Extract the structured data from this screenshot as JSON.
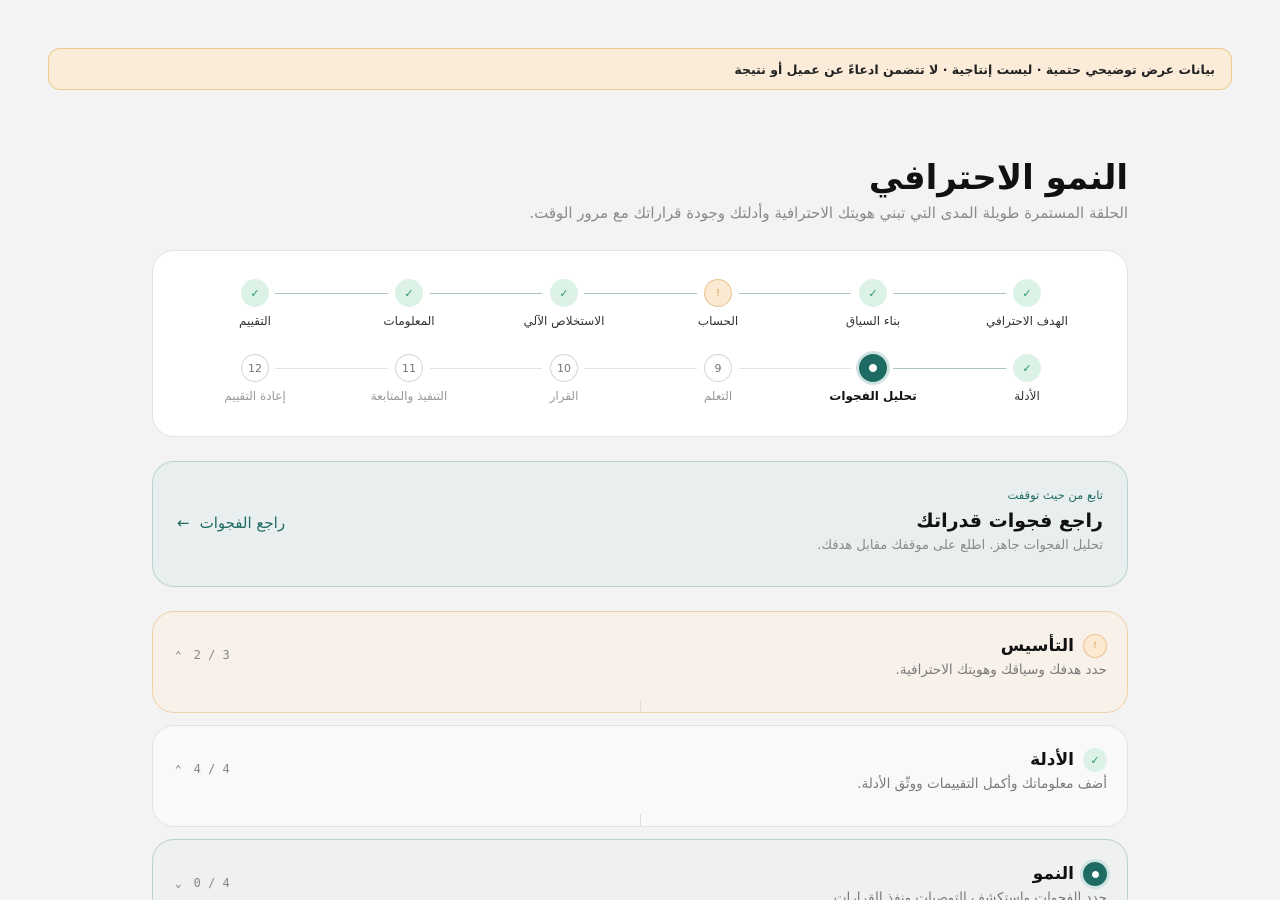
{
  "banner": {
    "text": "بيانات عرض توضيحي حتمية · ليست إنتاجية · لا تتضمن ادعاءً عن عميل أو نتيجة"
  },
  "header": {
    "title": "النمو الاحترافي",
    "subtitle": "الحلقة المستمرة طويلة المدى التي تبني هويتك الاحترافية وأدلتك وجودة قراراتك مع مرور الوقت."
  },
  "stepper": {
    "row1": [
      {
        "label": "الهدف الاحترافي",
        "status": "done",
        "marker": "✓"
      },
      {
        "label": "بناء السياق",
        "status": "done",
        "marker": "✓"
      },
      {
        "label": "الحساب",
        "status": "warn",
        "marker": "!"
      },
      {
        "label": "الاستخلاص الآلي",
        "status": "done",
        "marker": "✓"
      },
      {
        "label": "المعلومات",
        "status": "done",
        "marker": "✓"
      },
      {
        "label": "التقييم",
        "status": "done",
        "marker": "✓"
      }
    ],
    "row2": [
      {
        "label": "الأدلة",
        "status": "done",
        "marker": "✓"
      },
      {
        "label": "تحليل الفجوات",
        "status": "current",
        "marker": ""
      },
      {
        "label": "التعلم",
        "status": "todo",
        "marker": "9"
      },
      {
        "label": "القرار",
        "status": "todo",
        "marker": "10"
      },
      {
        "label": "التنفيذ والمتابعة",
        "status": "todo",
        "marker": "11"
      },
      {
        "label": "إعادة التقييم",
        "status": "todo",
        "marker": "12"
      }
    ]
  },
  "continue_card": {
    "eyebrow": "تابع من حيث توقفت",
    "title": "راجع فجوات قدراتك",
    "description": "تحليل الفجوات جاهز. اطلع على موقفك مقابل هدفك.",
    "link_label": "راجع الفجوات",
    "link_arrow": "←"
  },
  "phases": [
    {
      "title": "التأسيس",
      "description": "حدد هدفك وسياقك وهويتك الاحترافية.",
      "count": "2 / 3",
      "status": "warn",
      "marker": "!",
      "chevron": "⌃"
    },
    {
      "title": "الأدلة",
      "description": "أضف معلوماتك وأكمل التقييمات ووثّق الأدلة.",
      "count": "4 / 4",
      "status": "done",
      "marker": "✓",
      "chevron": "⌃"
    },
    {
      "title": "النمو",
      "description": "حدد الفجوات واستكشف التوصيات ونفذ القرارات.",
      "count": "0 / 4",
      "status": "current",
      "marker": "",
      "chevron": "⌄"
    }
  ]
}
